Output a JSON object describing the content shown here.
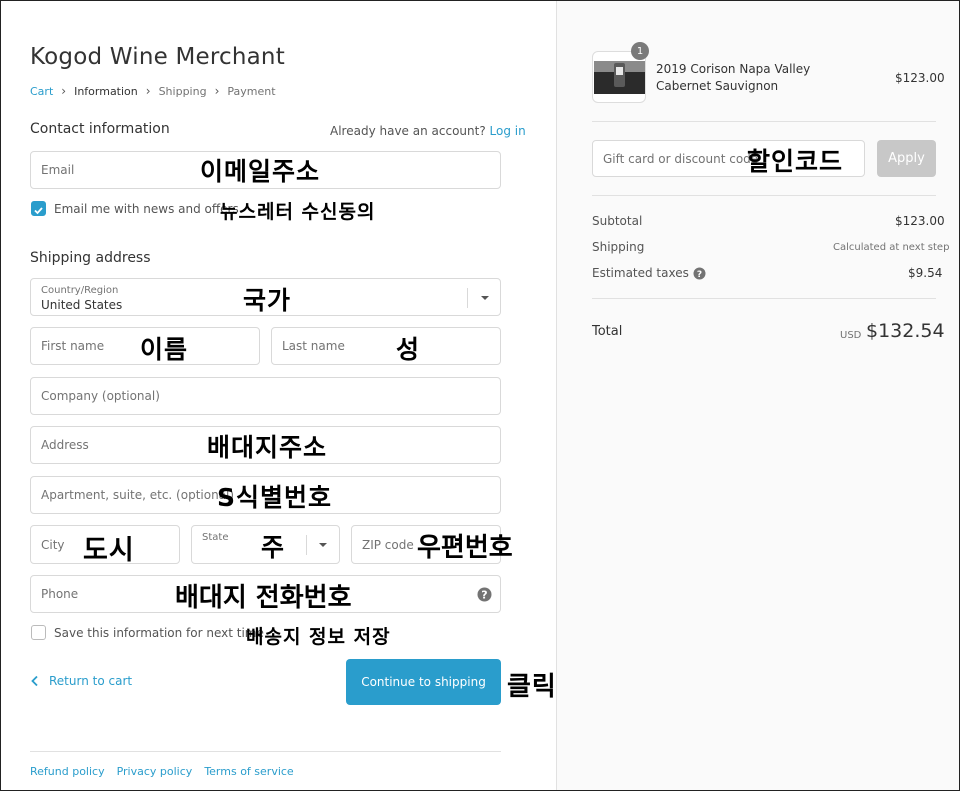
{
  "store_name": "Kogod Wine Merchant",
  "breadcrumb": [
    "Cart",
    "Information",
    "Shipping",
    "Payment"
  ],
  "contact": {
    "title": "Contact information",
    "already": "Already have an account?",
    "login": "Log in",
    "email_placeholder": "Email",
    "email_note": "이메일주소",
    "newsletter_label": "Email me with news and offers",
    "newsletter_note": "뉴스레터 수신동의"
  },
  "shipping": {
    "title": "Shipping address",
    "country_label": "Country/Region",
    "country_value": "United States",
    "country_note": "국가",
    "first_name": "First name",
    "first_name_note": "이름",
    "last_name": "Last name",
    "last_name_note": "성",
    "company": "Company (optional)",
    "address": "Address",
    "address_note": "배대지주소",
    "apartment": "Apartment, suite, etc. (optional)",
    "apartment_note": "S식별번호",
    "city": "City",
    "city_note": "도시",
    "state_label": "State",
    "state_note": "주",
    "zip": "ZIP code",
    "zip_note": "우편번호",
    "phone": "Phone",
    "phone_note": "배대지 전화번호",
    "save_label": "Save this information for next time",
    "save_note": "배송지 정보 저장"
  },
  "actions": {
    "return": "Return to cart",
    "continue": "Continue to shipping",
    "continue_note": "클릭"
  },
  "footer": [
    "Refund policy",
    "Privacy policy",
    "Terms of service"
  ],
  "order": {
    "qty_badge": "1",
    "product_name": "2019 Corison Napa Valley Cabernet Sauvignon",
    "product_price": "$123.00",
    "discount_placeholder": "Gift card or discount code",
    "discount_note": "할인코드",
    "apply": "Apply",
    "subtotal_label": "Subtotal",
    "subtotal": "$123.00",
    "shipping_label": "Shipping",
    "shipping_value": "Calculated at next step",
    "taxes_label": "Estimated taxes",
    "taxes": "$9.54",
    "total_label": "Total",
    "currency": "USD",
    "total": "$132.54"
  },
  "colors": {
    "accent": "#2a9dcc",
    "sidebar_bg": "#fafafa"
  }
}
